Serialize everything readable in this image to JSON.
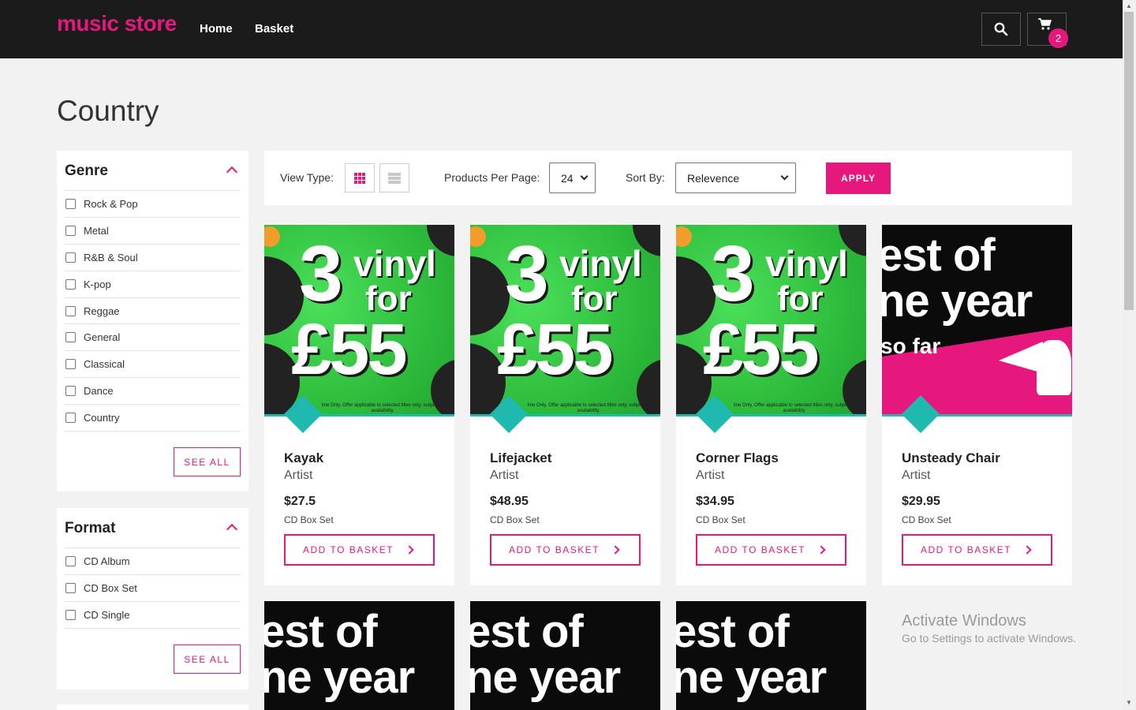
{
  "header": {
    "brand": "music store",
    "nav": [
      "Home",
      "Basket"
    ],
    "cart_count": "2"
  },
  "page": {
    "title": "Country"
  },
  "filters": {
    "genre": {
      "title": "Genre",
      "options": [
        "Rock & Pop",
        "Metal",
        "R&B & Soul",
        "K-pop",
        "Reggae",
        "General",
        "Classical",
        "Dance",
        "Country"
      ],
      "see_all": "SEE ALL"
    },
    "format": {
      "title": "Format",
      "options": [
        "CD Album",
        "CD Box Set",
        "CD Single"
      ],
      "see_all": "SEE ALL"
    }
  },
  "toolbar": {
    "view_type_label": "View Type:",
    "per_page_label": "Products Per Page:",
    "per_page_value": "24",
    "sort_label": "Sort By:",
    "sort_value": "Relevence",
    "apply_label": "APPLY"
  },
  "promo_art": {
    "three": "3",
    "vinyl": "vinyl",
    "for": "for",
    "price": "£55",
    "fine_print": "line Only. Offer applicable to selected titles only, subject to availability."
  },
  "best_art": {
    "line1": "est of",
    "line2": "ne year",
    "line3": "so far"
  },
  "products": [
    {
      "title": "Kayak",
      "artist": "Artist",
      "price": "$27.5",
      "format": "CD Box Set",
      "button": "ADD TO BASKET"
    },
    {
      "title": "Lifejacket",
      "artist": "Artist",
      "price": "$48.95",
      "format": "CD Box Set",
      "button": "ADD TO BASKET"
    },
    {
      "title": "Corner Flags",
      "artist": "Artist",
      "price": "$34.95",
      "format": "CD Box Set",
      "button": "ADD TO BASKET"
    },
    {
      "title": "Unsteady Chair",
      "artist": "Artist",
      "price": "$29.95",
      "format": "CD Box Set",
      "button": "ADD TO BASKET"
    }
  ],
  "watermark": {
    "line1": "Activate Windows",
    "line2": "Go to Settings to activate Windows."
  },
  "colors": {
    "accent": "#e6187e",
    "teal": "#1fb9b0",
    "header_bg": "#1b1b1b"
  }
}
